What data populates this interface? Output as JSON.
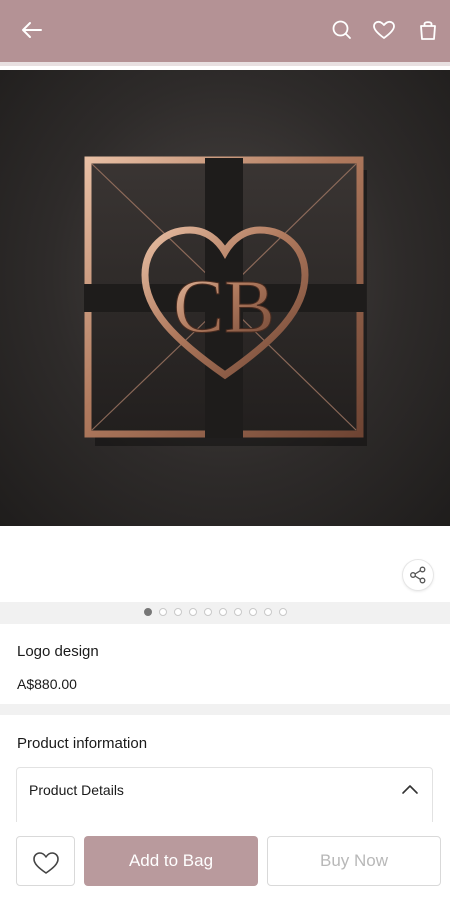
{
  "header": {
    "background": "#b49295",
    "icons": [
      "back-arrow-icon",
      "search-icon",
      "heart-icon",
      "bag-icon"
    ]
  },
  "hero": {
    "logo_text": "CB",
    "icons": [
      "logo-image"
    ]
  },
  "gallery": {
    "dot_count": 10,
    "active_index": 0
  },
  "product": {
    "name": "Logo design",
    "price": "A$880.00"
  },
  "info": {
    "title": "Product information",
    "accordion_label": "Product Details"
  },
  "actions": {
    "add_to_bag": "Add to Bag",
    "buy_now": "Buy Now",
    "accent_color": "#b99a9d"
  }
}
